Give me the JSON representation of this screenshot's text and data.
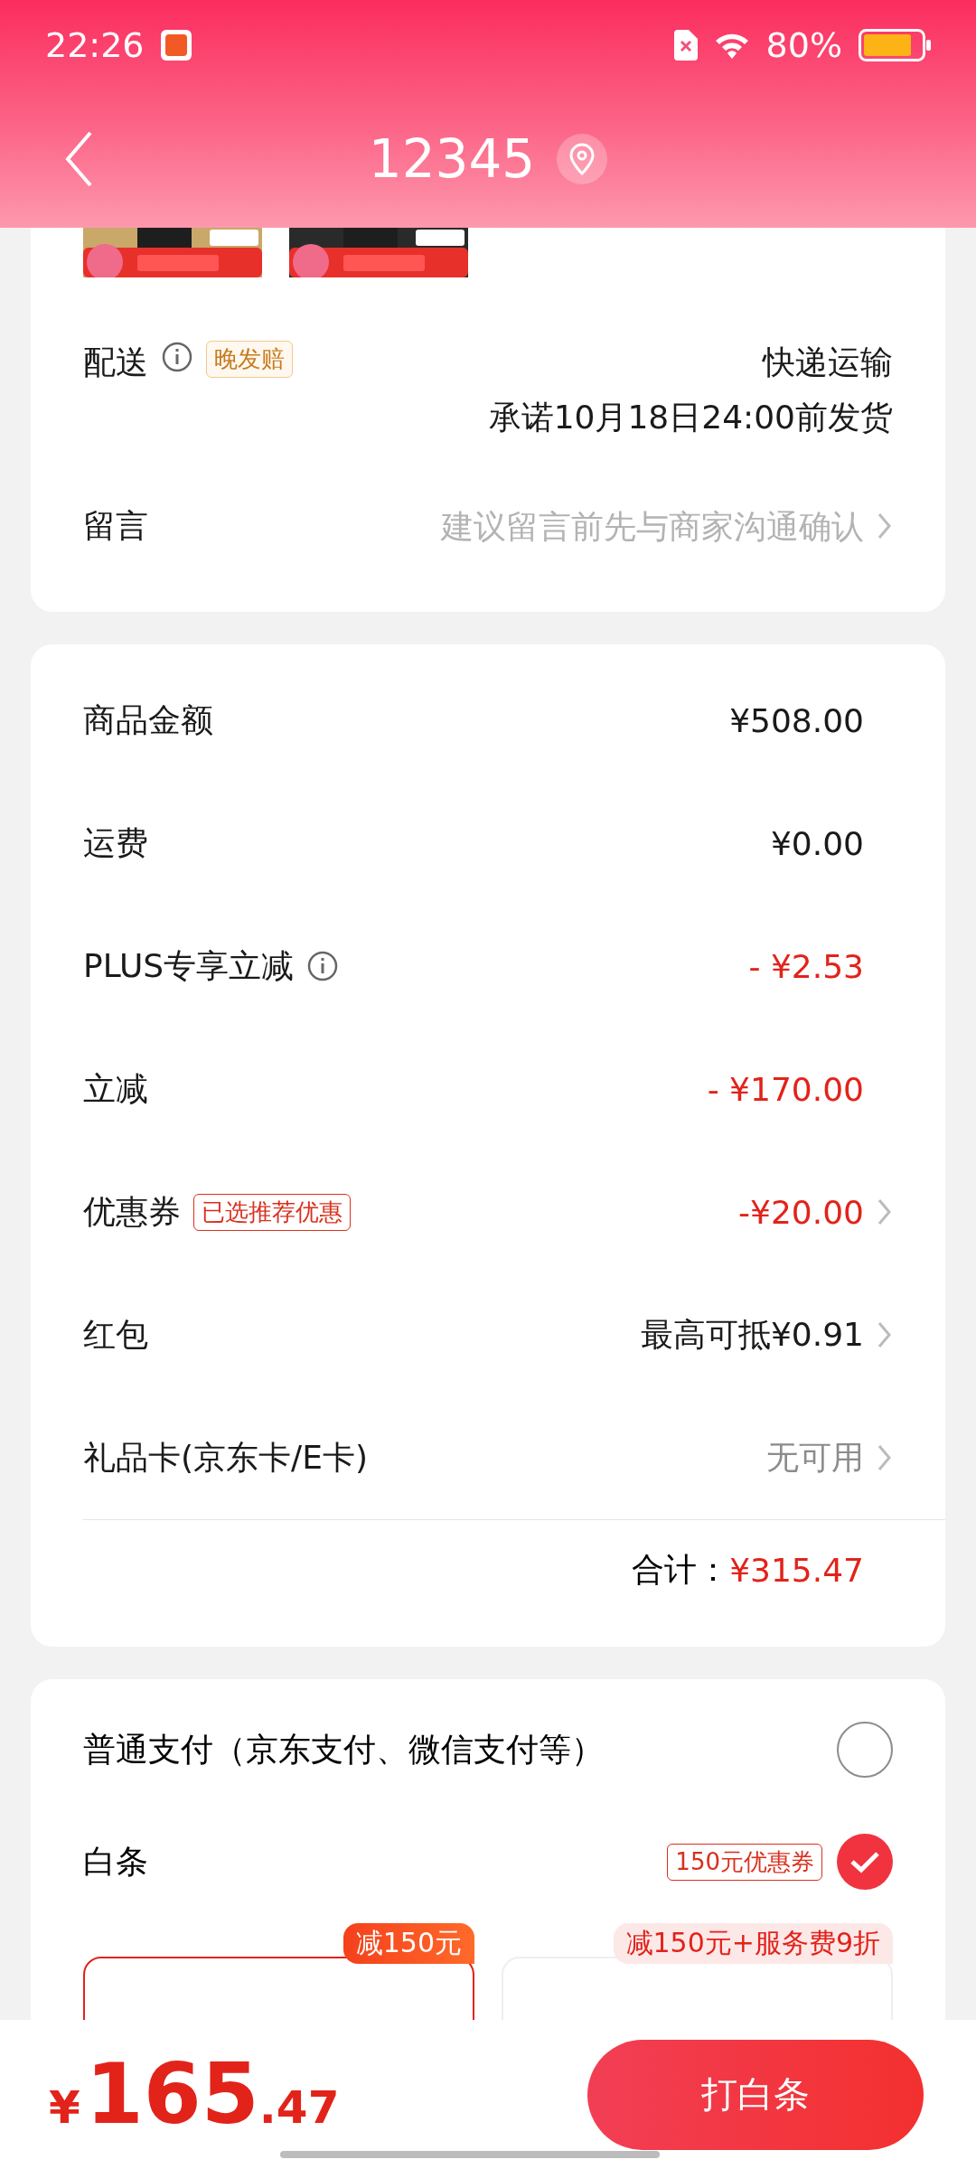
{
  "status_bar": {
    "time": "22:26",
    "battery": "80%"
  },
  "header": {
    "title": "12345"
  },
  "order_card": {
    "delivery": {
      "label": "配送",
      "tag": "晚发赔",
      "method": "快递运输",
      "promise": "承诺10月18日24:00前发货"
    },
    "message": {
      "label": "留言",
      "placeholder": "建议留言前先与商家沟通确认"
    }
  },
  "price_card": {
    "rows": [
      {
        "label": "商品金额",
        "value": "¥508.00",
        "kind": "normal",
        "info": false,
        "chevron": false
      },
      {
        "label": "运费",
        "value": "¥0.00",
        "kind": "normal",
        "info": false,
        "chevron": false
      },
      {
        "label": "PLUS专享立减",
        "value": "- ¥2.53",
        "kind": "discount",
        "info": true,
        "chevron": false
      },
      {
        "label": "立减",
        "value": "- ¥170.00",
        "kind": "discount",
        "info": false,
        "chevron": false
      },
      {
        "label": "优惠券",
        "tag": "已选推荐优惠",
        "value": "-¥20.00",
        "kind": "discount",
        "info": false,
        "chevron": true
      },
      {
        "label": "红包",
        "value": "最高可抵¥0.91",
        "kind": "normal",
        "info": false,
        "chevron": true
      },
      {
        "label": "礼品卡(京东卡/E卡)",
        "value": "无可用",
        "kind": "muted",
        "info": false,
        "chevron": true
      }
    ],
    "total_label": "合计：",
    "total": "¥315.47"
  },
  "payment_card": {
    "options": [
      {
        "label": "普通支付（京东支付、微信支付等）",
        "selected": false
      },
      {
        "label": "白条",
        "tag": "150元优惠券",
        "selected": true
      }
    ],
    "plans": [
      {
        "badge": "减150元",
        "selected": true
      },
      {
        "badge": "减150元+服务费9折",
        "selected": false
      }
    ]
  },
  "bottom_bar": {
    "currency": "¥",
    "price_int": "165",
    "price_dec": ".47",
    "button": "打白条"
  }
}
